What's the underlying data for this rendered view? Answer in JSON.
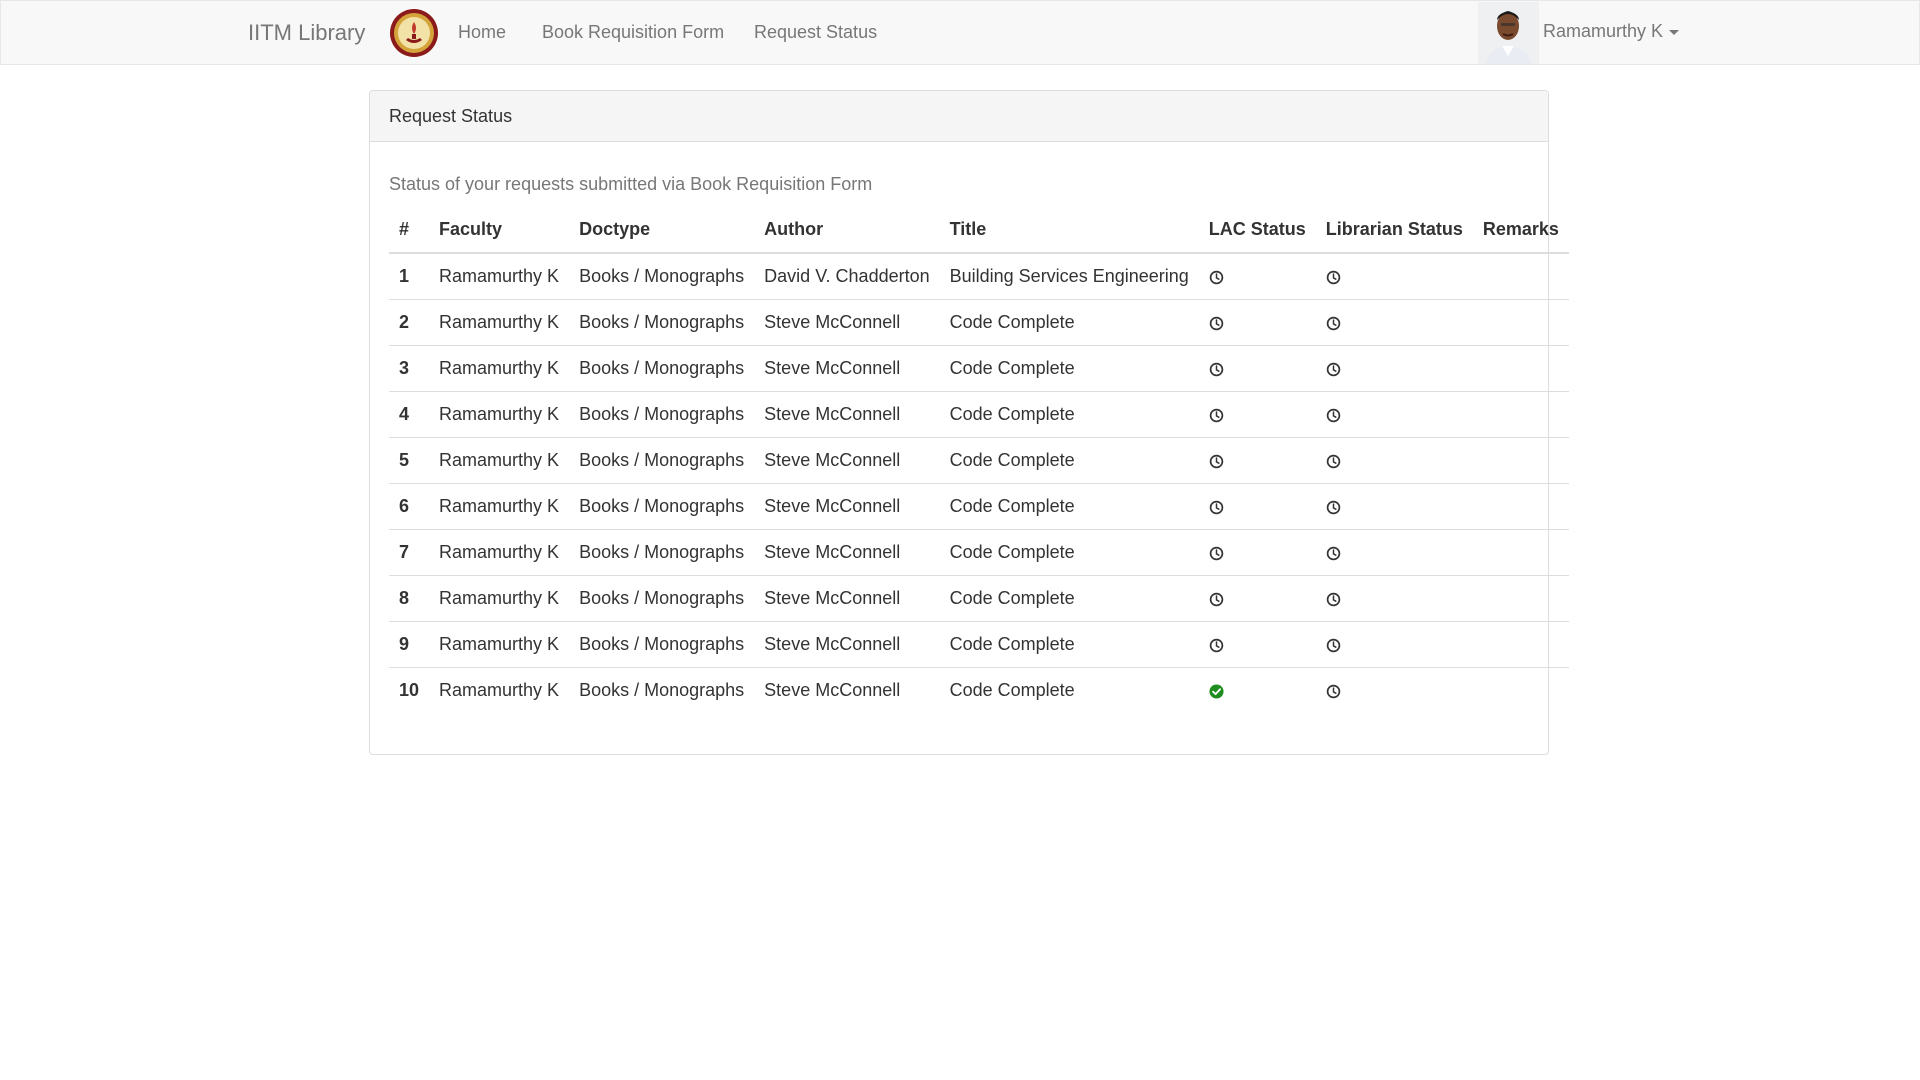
{
  "navbar": {
    "brand": "IITM Library",
    "links": [
      "Home",
      "Book Requisition Form",
      "Request Status"
    ],
    "user_name": "Ramamurthy K"
  },
  "panel": {
    "heading": "Request Status",
    "subtitle": "Status of your requests submitted via Book Requisition Form"
  },
  "table": {
    "headers": [
      "#",
      "Faculty",
      "Doctype",
      "Author",
      "Title",
      "LAC Status",
      "Librarian Status",
      "Remarks"
    ],
    "rows": [
      {
        "num": "1",
        "faculty": "Ramamurthy K",
        "doctype": "Books / Monographs",
        "author": "David V. Chadderton",
        "title": "Building Services Engineering",
        "lac_status": "pending-clock-icon",
        "librarian_status": "pending-clock-icon",
        "remarks": ""
      },
      {
        "num": "2",
        "faculty": "Ramamurthy K",
        "doctype": "Books / Monographs",
        "author": "Steve McConnell",
        "title": "Code Complete",
        "lac_status": "pending-clock-icon",
        "librarian_status": "pending-clock-icon",
        "remarks": ""
      },
      {
        "num": "3",
        "faculty": "Ramamurthy K",
        "doctype": "Books / Monographs",
        "author": "Steve McConnell",
        "title": "Code Complete",
        "lac_status": "pending-clock-icon",
        "librarian_status": "pending-clock-icon",
        "remarks": ""
      },
      {
        "num": "4",
        "faculty": "Ramamurthy K",
        "doctype": "Books / Monographs",
        "author": "Steve McConnell",
        "title": "Code Complete",
        "lac_status": "pending-clock-icon",
        "librarian_status": "pending-clock-icon",
        "remarks": ""
      },
      {
        "num": "5",
        "faculty": "Ramamurthy K",
        "doctype": "Books / Monographs",
        "author": "Steve McConnell",
        "title": "Code Complete",
        "lac_status": "pending-clock-icon",
        "librarian_status": "pending-clock-icon",
        "remarks": ""
      },
      {
        "num": "6",
        "faculty": "Ramamurthy K",
        "doctype": "Books / Monographs",
        "author": "Steve McConnell",
        "title": "Code Complete",
        "lac_status": "pending-clock-icon",
        "librarian_status": "pending-clock-icon",
        "remarks": ""
      },
      {
        "num": "7",
        "faculty": "Ramamurthy K",
        "doctype": "Books / Monographs",
        "author": "Steve McConnell",
        "title": "Code Complete",
        "lac_status": "pending-clock-icon",
        "librarian_status": "pending-clock-icon",
        "remarks": ""
      },
      {
        "num": "8",
        "faculty": "Ramamurthy K",
        "doctype": "Books / Monographs",
        "author": "Steve McConnell",
        "title": "Code Complete",
        "lac_status": "pending-clock-icon",
        "librarian_status": "pending-clock-icon",
        "remarks": ""
      },
      {
        "num": "9",
        "faculty": "Ramamurthy K",
        "doctype": "Books / Monographs",
        "author": "Steve McConnell",
        "title": "Code Complete",
        "lac_status": "pending-clock-icon",
        "librarian_status": "pending-clock-icon",
        "remarks": ""
      },
      {
        "num": "10",
        "faculty": "Ramamurthy K",
        "doctype": "Books / Monographs",
        "author": "Steve McConnell",
        "title": "Code Complete",
        "lac_status": "approved-check-icon",
        "librarian_status": "pending-clock-icon",
        "remarks": ""
      }
    ]
  },
  "colors": {
    "navbar_bg": "#f8f8f8",
    "nav_text": "#777777",
    "approved": "#1e8c1e",
    "pending": "#333333"
  }
}
